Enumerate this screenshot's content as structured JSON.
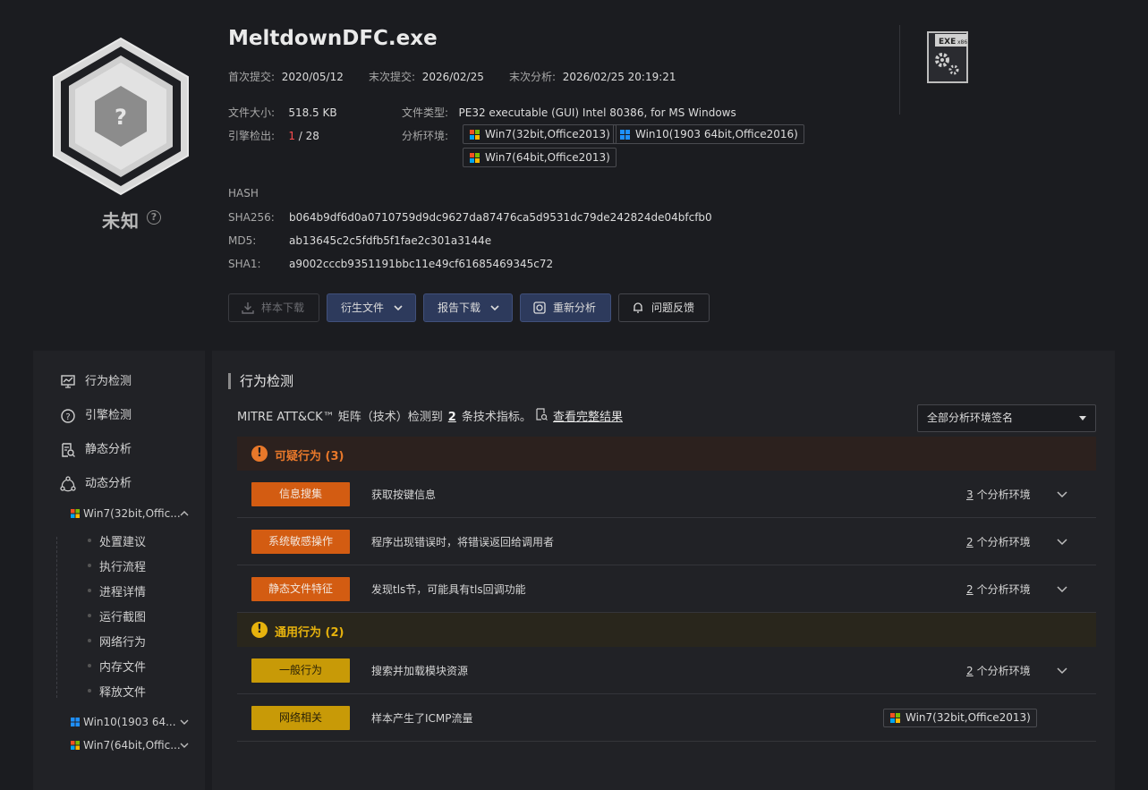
{
  "verdict": {
    "label": "未知",
    "help_icon": "question-circle-icon",
    "shield_icon": "question-hexagon-icon"
  },
  "file": {
    "name": "MeltdownDFC.exe",
    "first_submit_label": "首次提交:",
    "first_submit": "2020/05/12",
    "last_submit_label": "末次提交:",
    "last_submit": "2026/02/25",
    "last_analysis_label": "末次分析:",
    "last_analysis": "2026/02/25 20:19:21",
    "size_label": "文件大小:",
    "size": "518.5 KB",
    "engine_label": "引擎检出:",
    "engine_hits": "1",
    "engine_total": "/ 28",
    "type_label": "文件类型:",
    "type": "PE32 executable (GUI) Intel 80386, for MS Windows",
    "env_label": "分析环境:",
    "envs": [
      "Win7(32bit,Office2013)",
      "Win10(1903 64bit,Office2016)",
      "Win7(64bit,Office2013)"
    ],
    "hash_heading": "HASH",
    "sha256_label": "SHA256:",
    "sha256": "b064b9df6d0a0710759d9dc9627da87476ca5d9531dc79de242824de04bfcfb0",
    "md5_label": "MD5:",
    "md5": "ab13645c2c5fdfb5f1fae2c301a3144e",
    "sha1_label": "SHA1:",
    "sha1": "a9002cccb9351191bbc11e49cf61685469345c72",
    "exe_badge": "EXE",
    "exe_arch": "x86"
  },
  "actions": {
    "download": "样本下载",
    "derived": "衍生文件",
    "report": "报告下载",
    "reanalyze": "重新分析",
    "feedback": "问题反馈"
  },
  "sidebar": {
    "items": [
      "行为检测",
      "引擎检测",
      "静态分析",
      "动态分析"
    ],
    "envs": [
      "Win7(32bit,Offic...",
      "Win10(1903 64...",
      "Win7(64bit,Offic..."
    ],
    "sub_items": [
      "处置建议",
      "执行流程",
      "进程详情",
      "运行截图",
      "网络行为",
      "内存文件",
      "释放文件"
    ]
  },
  "main": {
    "title": "行为检测",
    "mitre_prefix": "MITRE ATT&CK™ 矩阵（技术）检测到",
    "mitre_count": "2",
    "mitre_suffix": "条技术指标。",
    "full_results": "查看完整结果",
    "select_value": "全部分析环境签名",
    "groups": [
      {
        "title": "可疑行为 (3)",
        "color": "#e8782a"
      },
      {
        "title": "通用行为 (2)",
        "color": "#e6b20d"
      }
    ],
    "rows": [
      {
        "tag": "信息搜集",
        "desc": "获取按键信息",
        "count": "3",
        "count_suffix": "个分析环境"
      },
      {
        "tag": "系统敏感操作",
        "desc": "程序出现错误时，将错误返回给调用者",
        "count": "2",
        "count_suffix": "个分析环境"
      },
      {
        "tag": "静态文件特征",
        "desc": "发现tls节，可能具有tls回调功能",
        "count": "2",
        "count_suffix": "个分析环境"
      },
      {
        "tag": "一般行为",
        "desc": "搜索并加载模块资源",
        "count": "2",
        "count_suffix": "个分析环境"
      },
      {
        "tag": "网络相关",
        "desc": "样本产生了ICMP流量",
        "env": "Win7(32bit,Office2013)"
      }
    ]
  }
}
